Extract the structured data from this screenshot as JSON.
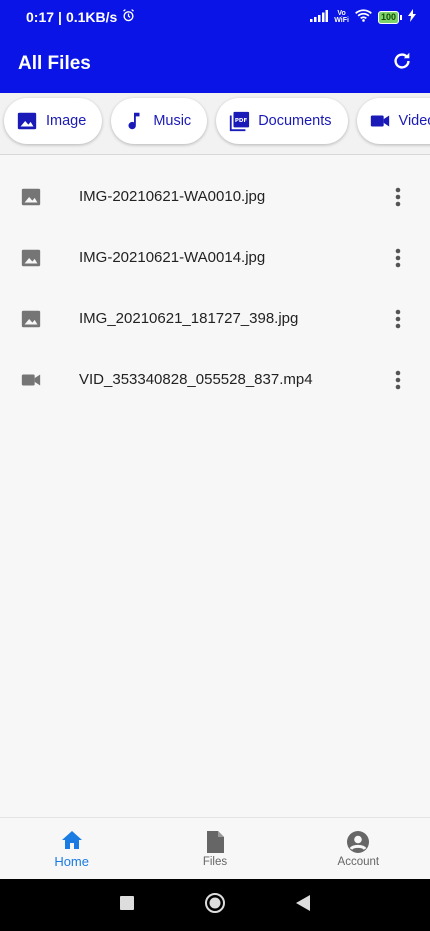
{
  "status_bar": {
    "time": "0:17",
    "speed": "0.1KB/s",
    "vowifi_top": "Vo",
    "vowifi_bottom": "WiFi",
    "battery": "100"
  },
  "app_bar": {
    "title": "All Files",
    "refresh_icon": "refresh-icon"
  },
  "categories": [
    {
      "label": "Image",
      "icon": "image-icon"
    },
    {
      "label": "Music",
      "icon": "music-note-icon"
    },
    {
      "label": "Documents",
      "icon": "pdf-icon"
    },
    {
      "label": "Videos",
      "icon": "videocam-icon"
    }
  ],
  "files": [
    {
      "name": "IMG-20210621-WA0010.jpg",
      "type": "image"
    },
    {
      "name": "IMG-20210621-WA0014.jpg",
      "type": "image"
    },
    {
      "name": "IMG_20210621_181727_398.jpg",
      "type": "image"
    },
    {
      "name": "VID_353340828_055528_837.mp4",
      "type": "video"
    }
  ],
  "bottom_nav": [
    {
      "label": "Home",
      "icon": "home-icon",
      "active": true
    },
    {
      "label": "Files",
      "icon": "file-icon",
      "active": false
    },
    {
      "label": "Account",
      "icon": "account-circle-icon",
      "active": false
    }
  ],
  "colors": {
    "primary": "#0a14e6",
    "chip_text": "#1a1ab8",
    "active_nav": "#1a7be3"
  }
}
